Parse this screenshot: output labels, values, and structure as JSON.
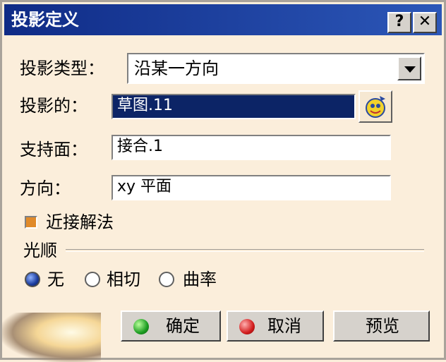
{
  "window": {
    "title": "投影定义",
    "help_label": "?",
    "close_label": "✕"
  },
  "form": {
    "projection_type": {
      "label": "投影类型：",
      "value": "沿某一方向"
    },
    "projected": {
      "label": "投影的：",
      "value": "草图.11"
    },
    "support": {
      "label": "支持面：",
      "value": "接合.1"
    },
    "direction": {
      "label": "方向：",
      "value": "xy 平面"
    },
    "nearest_solution": {
      "label": "近接解法",
      "checked": true
    }
  },
  "smoothing": {
    "title": "光顺",
    "options": [
      {
        "label": "无",
        "selected": true
      },
      {
        "label": "相切",
        "selected": false
      },
      {
        "label": "曲率",
        "selected": false
      }
    ]
  },
  "buttons": {
    "ok": "确定",
    "cancel": "取消",
    "preview": "预览"
  }
}
